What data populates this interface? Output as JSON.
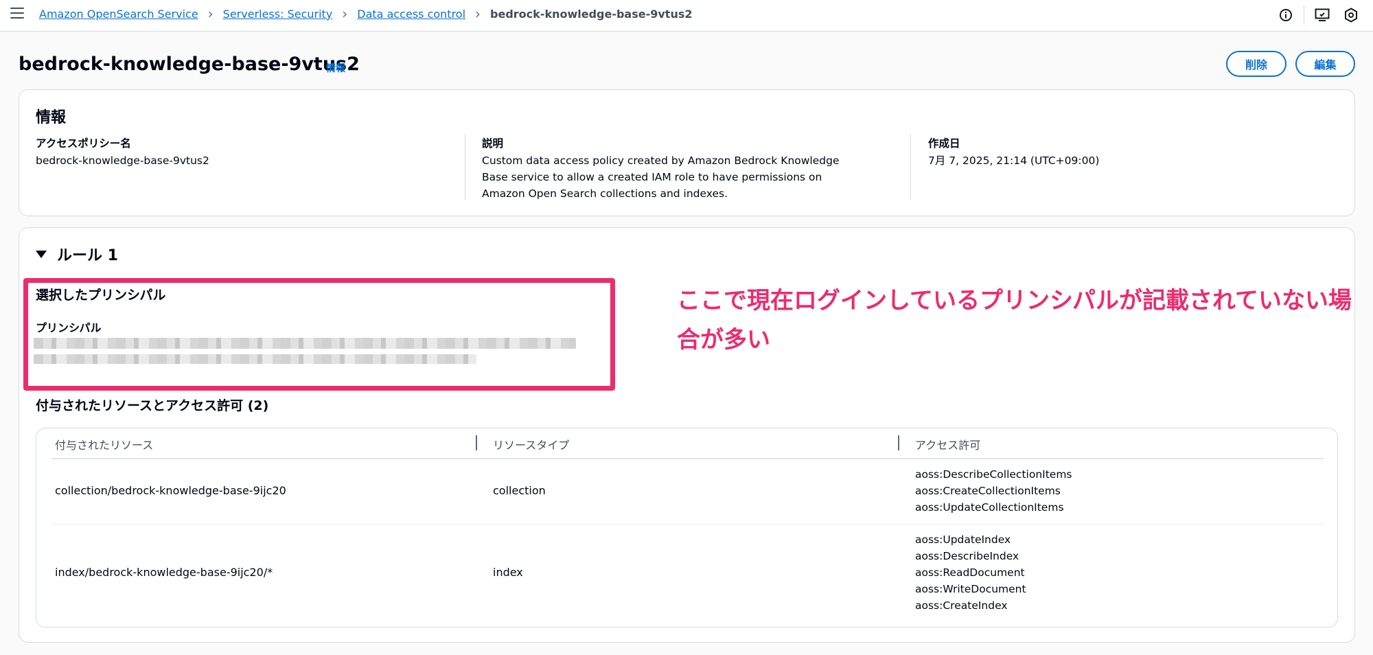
{
  "breadcrumb": {
    "items": [
      "Amazon OpenSearch Service",
      "Serverless: Security",
      "Data access control"
    ],
    "current": "bedrock-knowledge-base-9vtus2"
  },
  "header": {
    "title": "bedrock-knowledge-base-9vtus2",
    "info_link": "情報",
    "delete_label": "削除",
    "edit_label": "編集"
  },
  "details": {
    "heading": "情報",
    "policy_name_label": "アクセスポリシー名",
    "policy_name": "bedrock-knowledge-base-9vtus2",
    "description_label": "説明",
    "description": "Custom data access policy created by Amazon Bedrock Knowledge Base service to allow a created IAM role to have permissions on Amazon Open Search collections and indexes.",
    "created_label": "作成日",
    "created": "7月 7, 2025, 21:14 (UTC+09:00)"
  },
  "rule": {
    "title": "ルール 1",
    "selected_principals_heading": "選択したプリンシパル",
    "principal_label": "プリンシパル",
    "annotation": "ここで現在ログインしているプリンシパルが記載されていない場合が多い",
    "resources_heading": "付与されたリソースとアクセス許可 (2)",
    "table": {
      "columns": [
        "付与されたリソース",
        "リソースタイプ",
        "アクセス許可"
      ],
      "rows": [
        {
          "resource": "collection/bedrock-knowledge-base-9ijc20",
          "type": "collection",
          "permissions": [
            "aoss:DescribeCollectionItems",
            "aoss:CreateCollectionItems",
            "aoss:UpdateCollectionItems"
          ]
        },
        {
          "resource": "index/bedrock-knowledge-base-9ijc20/*",
          "type": "index",
          "permissions": [
            "aoss:UpdateIndex",
            "aoss:DescribeIndex",
            "aoss:ReadDocument",
            "aoss:WriteDocument",
            "aoss:CreateIndex"
          ]
        }
      ]
    }
  },
  "icons": [
    "menu-icon",
    "info-icon",
    "feedback-icon",
    "settings-icon",
    "caret-down-icon"
  ],
  "colors": {
    "link": "#0972d3",
    "annotation": "#ed2b6f",
    "border": "#d5dbdb"
  }
}
